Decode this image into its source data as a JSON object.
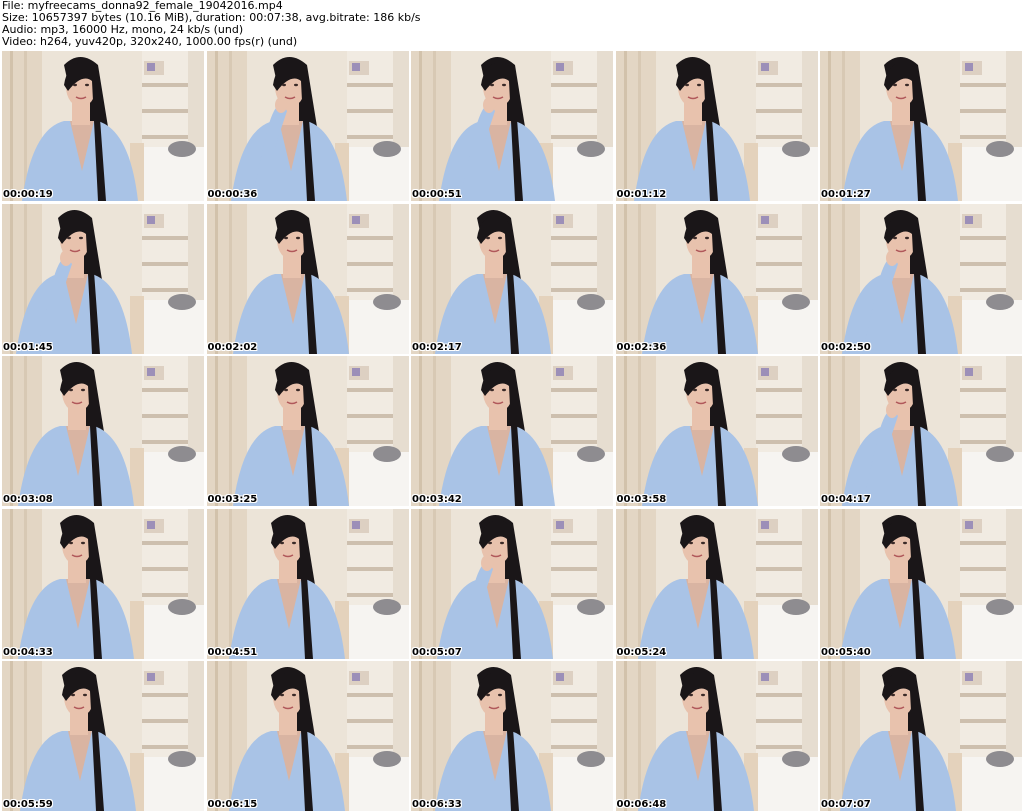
{
  "header": {
    "file_line": "File: myfreecams_donna92_female_19042016.mp4",
    "size_line": "Size: 10657397 bytes (10.16 MiB), duration: 00:07:38, avg.bitrate: 186 kb/s",
    "audio_line": "Audio: mp3, 16000 Hz, mono, 24 kb/s (und)",
    "video_line": "Video: h264, yuv420p, 320x240, 1000.00 fps(r) (und)"
  },
  "thumbnails": [
    {
      "timestamp": "00:00:19"
    },
    {
      "timestamp": "00:00:36"
    },
    {
      "timestamp": "00:00:51"
    },
    {
      "timestamp": "00:01:12"
    },
    {
      "timestamp": "00:01:27"
    },
    {
      "timestamp": "00:01:45"
    },
    {
      "timestamp": "00:02:02"
    },
    {
      "timestamp": "00:02:17"
    },
    {
      "timestamp": "00:02:36"
    },
    {
      "timestamp": "00:02:50"
    },
    {
      "timestamp": "00:03:08"
    },
    {
      "timestamp": "00:03:25"
    },
    {
      "timestamp": "00:03:42"
    },
    {
      "timestamp": "00:03:58"
    },
    {
      "timestamp": "00:04:17"
    },
    {
      "timestamp": "00:04:33"
    },
    {
      "timestamp": "00:04:51"
    },
    {
      "timestamp": "00:05:07"
    },
    {
      "timestamp": "00:05:24"
    },
    {
      "timestamp": "00:05:40"
    },
    {
      "timestamp": "00:05:59"
    },
    {
      "timestamp": "00:06:15"
    },
    {
      "timestamp": "00:06:33"
    },
    {
      "timestamp": "00:06:48"
    },
    {
      "timestamp": "00:07:07"
    }
  ],
  "colors": {
    "wall": "#ece4d8",
    "curtain": "#e3d6c4",
    "shelf": "#f4efe8",
    "bed": "#f6f4f1",
    "shirt": "#a9c3e6",
    "hair": "#1a1618",
    "skin": "#e8c2ad"
  }
}
